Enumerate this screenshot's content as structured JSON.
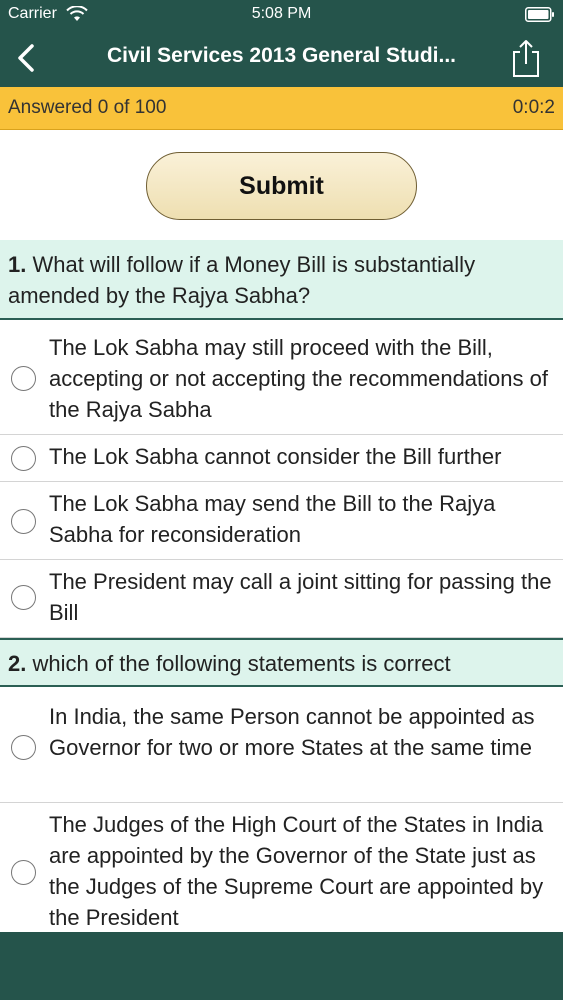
{
  "status_bar": {
    "carrier": "Carrier",
    "time": "5:08 PM",
    "wifi_icon": "wifi-icon",
    "battery_icon": "battery-icon"
  },
  "nav": {
    "title": "Civil Services 2013 General Studi...",
    "back_icon": "chevron-left-icon",
    "share_icon": "share-icon"
  },
  "progress": {
    "answered": "Answered 0 of 100",
    "timer": "0:0:2"
  },
  "submit_label": "Submit",
  "questions": [
    {
      "number": "1.",
      "text": " What will follow if a Money Bill is substantially amended by the Rajya Sabha?",
      "options": [
        "The Lok Sabha may still proceed with the Bill, accepting or not accepting the recommendations of the Rajya Sabha",
        "The Lok Sabha cannot consider the Bill further",
        "The Lok Sabha may send the Bill to the Rajya Sabha for reconsideration",
        "The President may call a joint sitting for passing the Bill"
      ]
    },
    {
      "number": "2.",
      "text": " which of the following statements is correct",
      "options": [
        "In India, the same Person cannot be appointed as Governor for two or more States at the same time",
        "The Judges of the High Court of the States in India are appointed by the Governor of the State just as the Judges of the Supreme Court are appointed by the President"
      ]
    }
  ],
  "colors": {
    "header": "#25544b",
    "progress_bar": "#f9c23a",
    "question_bg": "#ddf4ec",
    "submit_bg": "#f3e7c4"
  }
}
